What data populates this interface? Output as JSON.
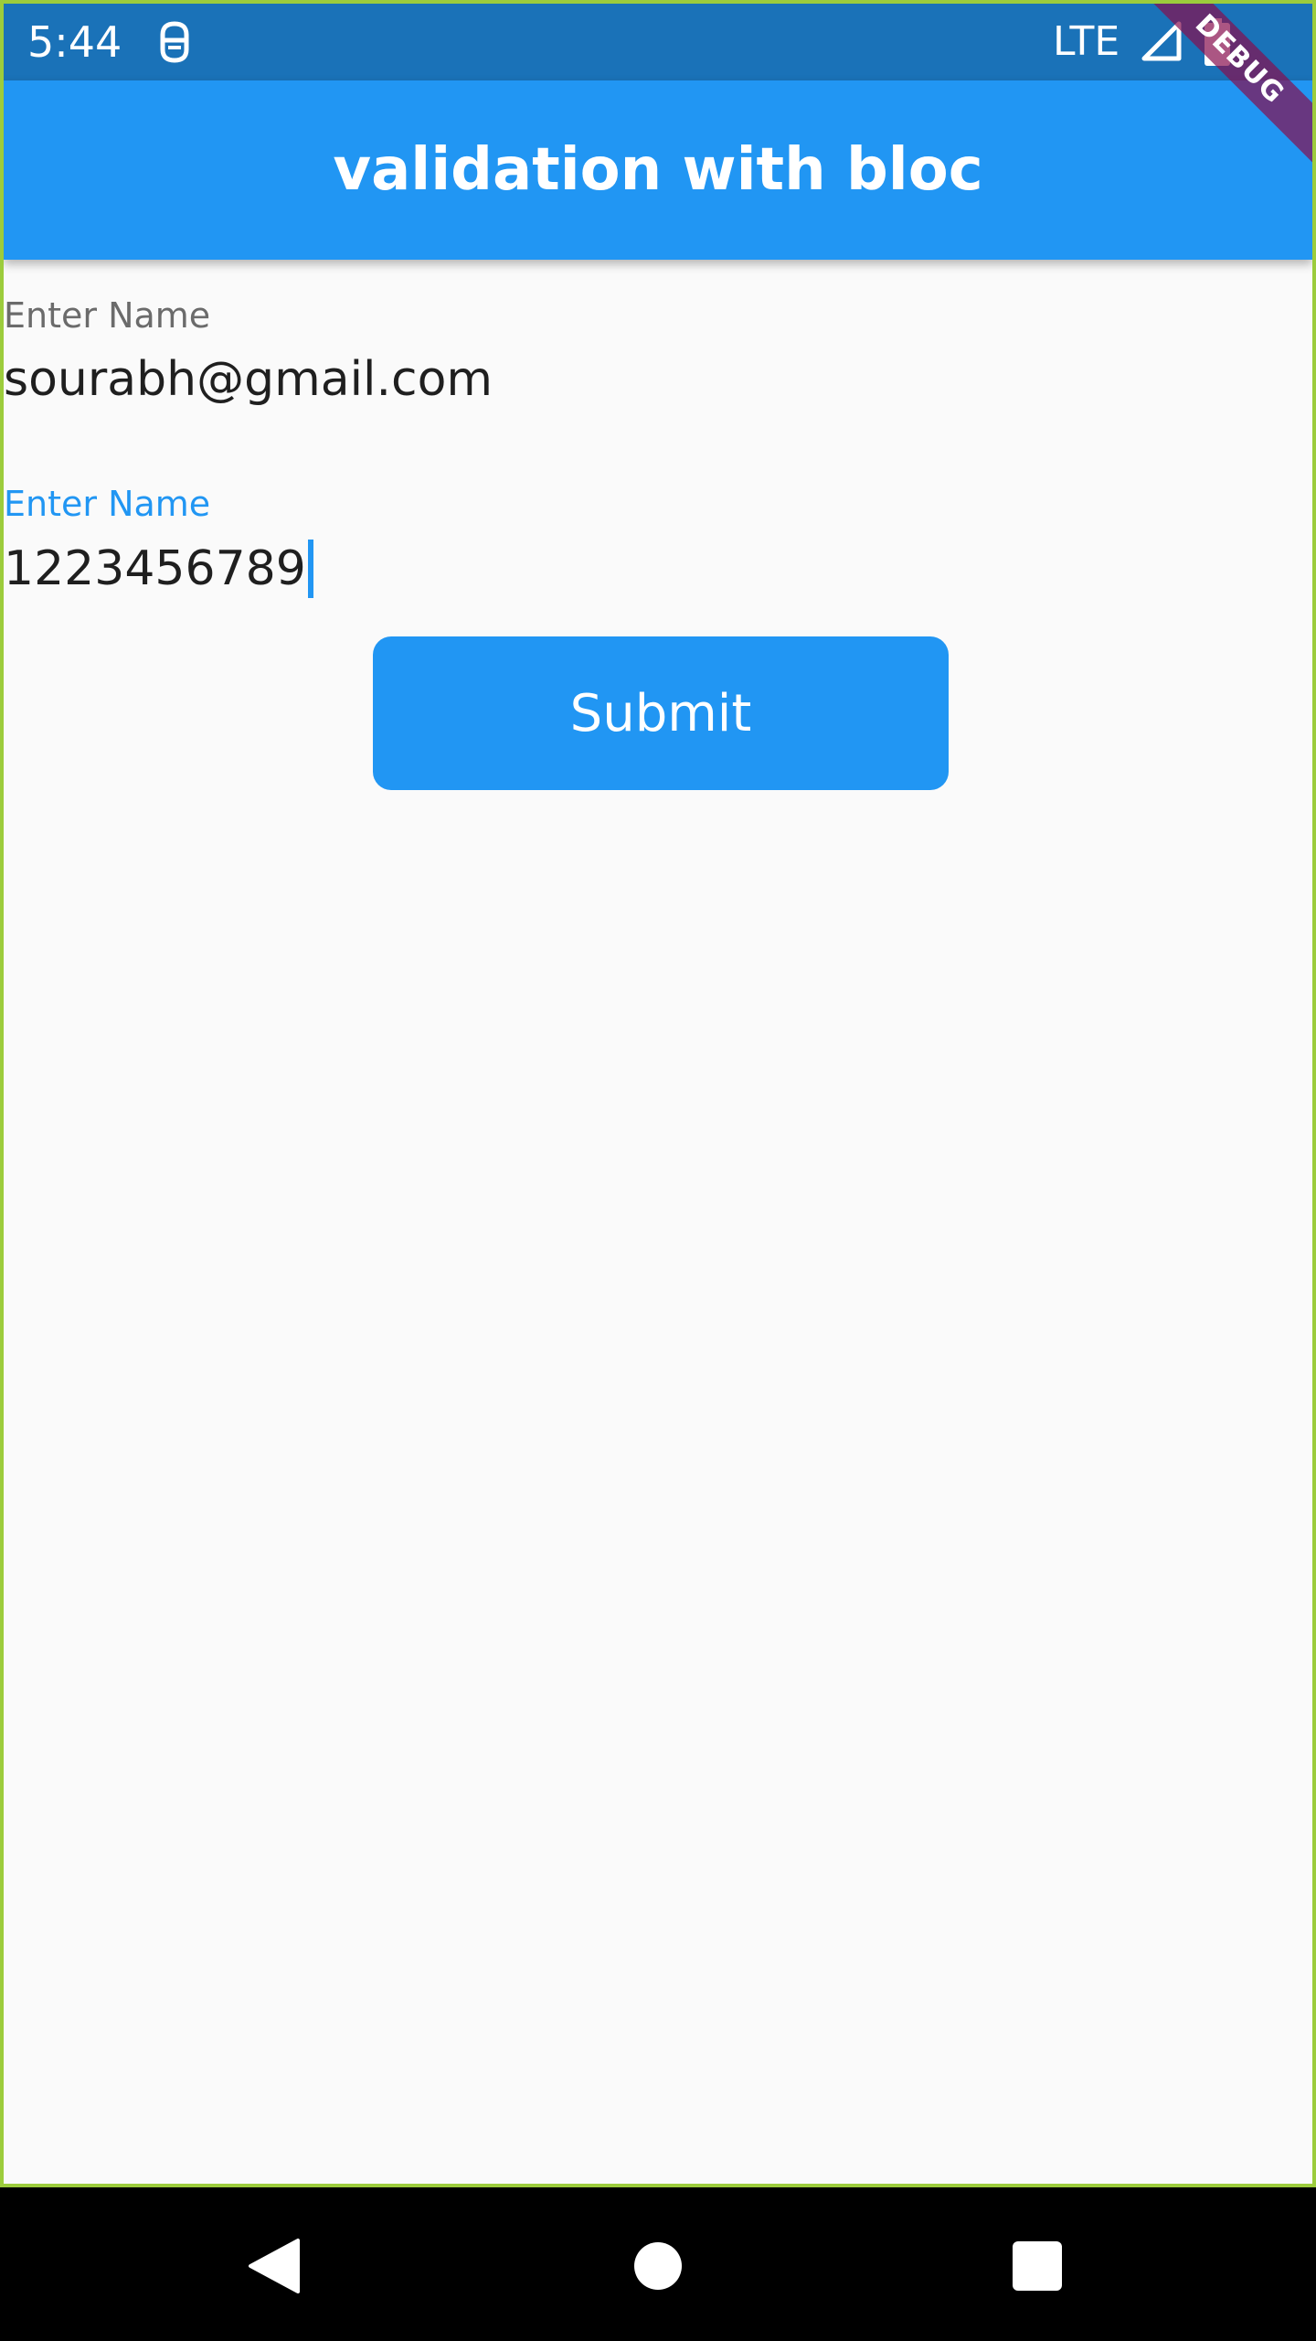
{
  "status_bar": {
    "time": "5:44",
    "network": "LTE",
    "app_icon": "android-debug-icon",
    "signal_icon": "signal-icon",
    "battery_icon": "battery-icon"
  },
  "app_bar": {
    "title": "validation with bloc",
    "debug_label": "DEBUG"
  },
  "form": {
    "fields": [
      {
        "label": "Enter Name",
        "value": "sourabh@gmail.com",
        "focused": false
      },
      {
        "label": "Enter Name",
        "value": "1223456789",
        "focused": true
      }
    ],
    "submit_label": "Submit"
  },
  "navigation": {
    "back_icon": "back-icon",
    "home_icon": "home-icon",
    "recents_icon": "recents-icon"
  },
  "colors": {
    "primary": "#2196F3",
    "status_bar": "#1A72B8",
    "background": "#FAFAFA",
    "debug_ribbon": "#880E4F"
  }
}
